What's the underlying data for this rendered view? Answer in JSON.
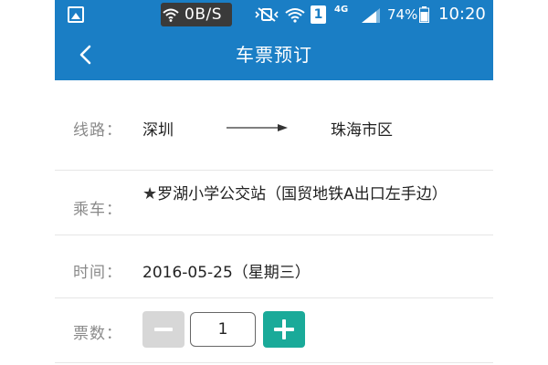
{
  "status_bar": {
    "network_speed": "0B/S",
    "sim_slot": "1",
    "network_type": "4G",
    "battery": "74%",
    "time": "10:20"
  },
  "header": {
    "title": "车票预订",
    "back_icon": "chevron-left-icon"
  },
  "form": {
    "route": {
      "label": "线路：",
      "from": "深圳",
      "to": "珠海市区"
    },
    "boarding": {
      "label": "乘车：",
      "star": "★",
      "value": "罗湖小学公交站（国贸地铁A出口左手边）"
    },
    "time": {
      "label": "时间：",
      "value": "2016-05-25（星期三）"
    },
    "tickets": {
      "label": "票数：",
      "quantity": "1"
    }
  },
  "colors": {
    "header_blue": "#1a7ec5",
    "plus_green": "#1aaa99",
    "minus_gray": "#d7d7d7"
  }
}
